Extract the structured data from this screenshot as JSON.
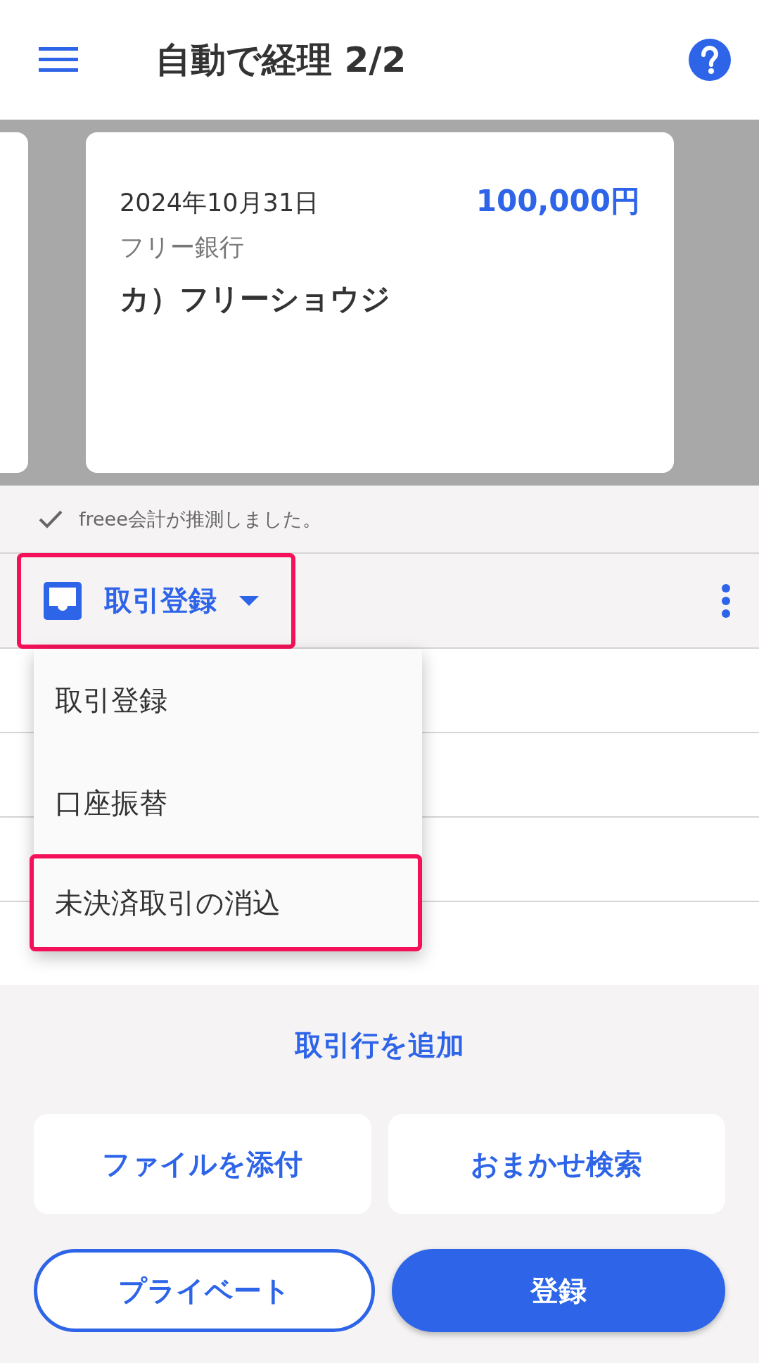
{
  "header": {
    "title": "自動で経理 2/2"
  },
  "card": {
    "date": "2024年10月31日",
    "amount": "100,000円",
    "bank": "フリー銀行",
    "payee": "カ）フリーショウジ"
  },
  "guess_note": "freee会計が推測しました。",
  "type_dropdown": {
    "value": "取引登録",
    "highlighted": true
  },
  "menu": [
    {
      "label": "取引登録",
      "highlighted": false
    },
    {
      "label": "口座振替",
      "highlighted": false
    },
    {
      "label": "未決済取引の消込",
      "highlighted": true
    }
  ],
  "add_row_link": "取引行を追加",
  "actions": [
    "ファイルを添付",
    "おまかせ検索"
  ],
  "bottom_buttons": [
    {
      "label": "プライベート",
      "kind": "outline"
    },
    {
      "label": "登録",
      "kind": "primary"
    }
  ]
}
